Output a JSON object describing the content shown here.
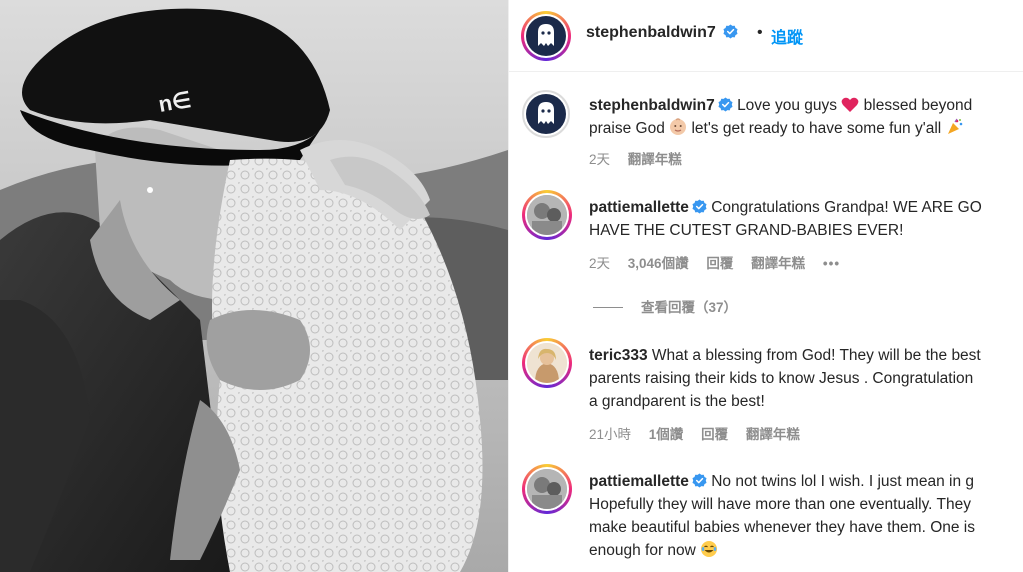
{
  "post_author": {
    "username": "stephenbaldwin7",
    "verified": true,
    "separator": "•",
    "follow_label": "追蹤"
  },
  "comments": [
    {
      "username": "stephenbaldwin7",
      "verified": true,
      "line1": "Love you guys",
      "line1b": "blessed beyond",
      "line2a": "praise God",
      "line2b": "let's get ready to have some fun y'all",
      "time": "2天",
      "translate": "翻譯年糕",
      "icons": [
        "heart-emoji",
        "baby-emoji",
        "party-popper-emoji"
      ]
    },
    {
      "username": "pattiemallette",
      "verified": true,
      "line1": "Congratulations Grandpa! WE ARE GO",
      "line2": "HAVE THE CUTEST GRAND-BABIES EVER!",
      "time": "2天",
      "likes": "3,046個讚",
      "reply": "回覆",
      "translate": "翻譯年糕",
      "more": "•••",
      "view_replies": "查看回覆（37）"
    },
    {
      "username": "teric333",
      "verified": false,
      "line1": "What a blessing from God! They will be the best",
      "line2": "parents raising their kids to know Jesus . Congratulation",
      "line3": "a grandparent is the best!",
      "time": "21小時",
      "likes": "1個讚",
      "reply": "回覆",
      "translate": "翻譯年糕"
    },
    {
      "username": "pattiemallette",
      "verified": true,
      "line1": "No not twins lol I wish. I just mean in g",
      "line2": "Hopefully they will have more than one eventually. They",
      "line3": "make beautiful babies whenever they have them. One is",
      "line4": "enough for now",
      "icons": [
        "laughing-emoji"
      ]
    }
  ],
  "colors": {
    "follow_blue": "#0095f6",
    "verified_blue": "#3897f0",
    "meta_gray": "#8e8e8e",
    "heart_red": "#e0245e"
  }
}
